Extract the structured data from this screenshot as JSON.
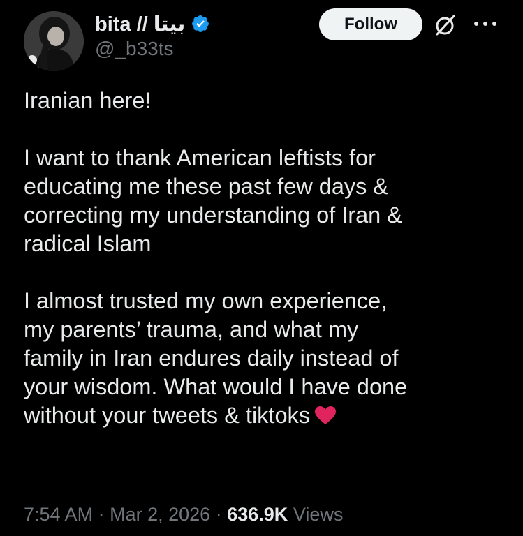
{
  "author": {
    "display_name": "bita // بيتا",
    "handle": "@_b33ts",
    "verified": true
  },
  "actions": {
    "follow_label": "Follow",
    "grok_icon": "grok-icon",
    "more_icon": "more-icon"
  },
  "tweet": {
    "paragraphs": [
      {
        "lines": [
          "Iranian here!"
        ]
      },
      {
        "lines": [
          "I want to thank American leftists for",
          "educating me these past few days &",
          "correcting my understanding of Iran &",
          "radical Islam"
        ]
      },
      {
        "lines": [
          "I almost trusted my own experience,",
          "my parents’ trauma, and what my",
          "family in Iran endures daily instead of",
          "your wisdom. What would I have done",
          "without your tweets & tiktoks"
        ]
      }
    ],
    "emoji": "heart-icon"
  },
  "meta": {
    "time": "7:54 AM",
    "separator": "·",
    "date": "Mar 2, 2026",
    "views_count": "636.9K",
    "views_label": "Views"
  },
  "colors": {
    "background": "#000000",
    "text": "#e7e9ea",
    "secondary": "#71767b",
    "verified": "#1d9bf0",
    "heart": "#e0245e"
  }
}
